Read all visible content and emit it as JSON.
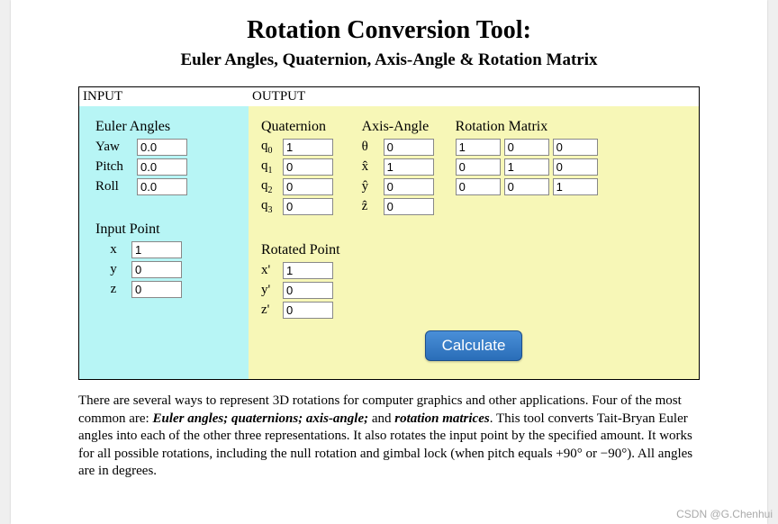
{
  "title": "Rotation Conversion Tool:",
  "subtitle": "Euler Angles, Quaternion, Axis-Angle & Rotation Matrix",
  "headers": {
    "input": "INPUT",
    "output": "OUTPUT"
  },
  "input": {
    "euler": {
      "title": "Euler Angles",
      "yaw_label": "Yaw",
      "yaw_value": "0.0",
      "pitch_label": "Pitch",
      "pitch_value": "0.0",
      "roll_label": "Roll",
      "roll_value": "0.0"
    },
    "point": {
      "title": "Input Point",
      "x_label": "x",
      "x_value": "1",
      "y_label": "y",
      "y_value": "0",
      "z_label": "z",
      "z_value": "0"
    }
  },
  "output": {
    "quat": {
      "title": "Quaternion",
      "q0_label": "q",
      "q0_sub": "0",
      "q0_value": "1",
      "q1_label": "q",
      "q1_sub": "1",
      "q1_value": "0",
      "q2_label": "q",
      "q2_sub": "2",
      "q2_value": "0",
      "q3_label": "q",
      "q3_sub": "3",
      "q3_value": "0"
    },
    "axis": {
      "title": "Axis-Angle",
      "theta_label": "θ",
      "theta_value": "0",
      "x_label": "x̂",
      "x_value": "1",
      "y_label": "ŷ",
      "y_value": "0",
      "z_label": "ẑ",
      "z_value": "0"
    },
    "matrix": {
      "title": "Rotation Matrix",
      "r00": "1",
      "r01": "0",
      "r02": "0",
      "r10": "0",
      "r11": "1",
      "r12": "0",
      "r20": "0",
      "r21": "0",
      "r22": "1"
    },
    "rpoint": {
      "title": "Rotated Point",
      "x_label": "x'",
      "x_value": "1",
      "y_label": "y'",
      "y_value": "0",
      "z_label": "z'",
      "z_value": "0"
    }
  },
  "calc_label": "Calculate",
  "description": {
    "p1a": "There are several ways to represent 3D rotations for computer graphics and other applications. Four of the most common are: ",
    "b1": "Euler angles; quaternions; axis-angle;",
    "p1b": " and ",
    "b2": "rotation matrices",
    "p1c": ". This tool converts Tait-Bryan Euler angles into each of the other three representations. It also rotates the input point by the specified amount. It works for all possible rotations, including the null rotation and gimbal lock (when pitch equals +90° or −90°). All angles are in degrees."
  },
  "watermark": "CSDN @G.Chenhui"
}
